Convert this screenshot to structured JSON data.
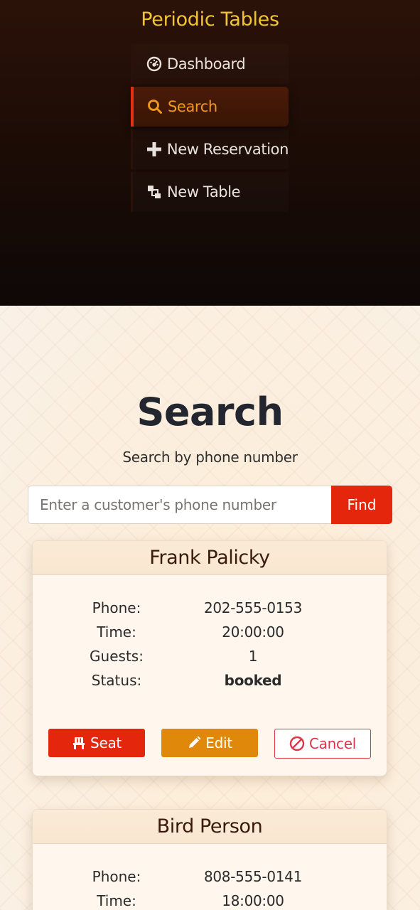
{
  "nav": {
    "brand": "Periodic Tables",
    "items": [
      {
        "label": "Dashboard",
        "icon": "dashboard-icon"
      },
      {
        "label": "Search",
        "icon": "search-icon",
        "active": true
      },
      {
        "label": "New Reservation",
        "icon": "plus-icon"
      },
      {
        "label": "New Table",
        "icon": "tables-icon"
      }
    ]
  },
  "page": {
    "title": "Search",
    "subtitle": "Search by phone number"
  },
  "search": {
    "placeholder": "Enter a customer's phone number",
    "value": "",
    "button_label": "Find"
  },
  "labels": {
    "phone": "Phone:",
    "time": "Time:",
    "guests": "Guests:",
    "status": "Status:"
  },
  "reservations": [
    {
      "name": "Frank Palicky",
      "phone": "202-555-0153",
      "time": "20:00:00",
      "guests": "1",
      "status": "booked",
      "actions": {
        "seat": "Seat",
        "edit": "Edit",
        "cancel": "Cancel"
      }
    },
    {
      "name": "Bird Person",
      "phone": "808-555-0141",
      "time": "18:00:00"
    }
  ],
  "colors": {
    "brand": "#f2c434",
    "accent": "#e3260c",
    "edit": "#e0880a",
    "cancel": "#dc3545",
    "nav_active": "#f29a1e"
  }
}
